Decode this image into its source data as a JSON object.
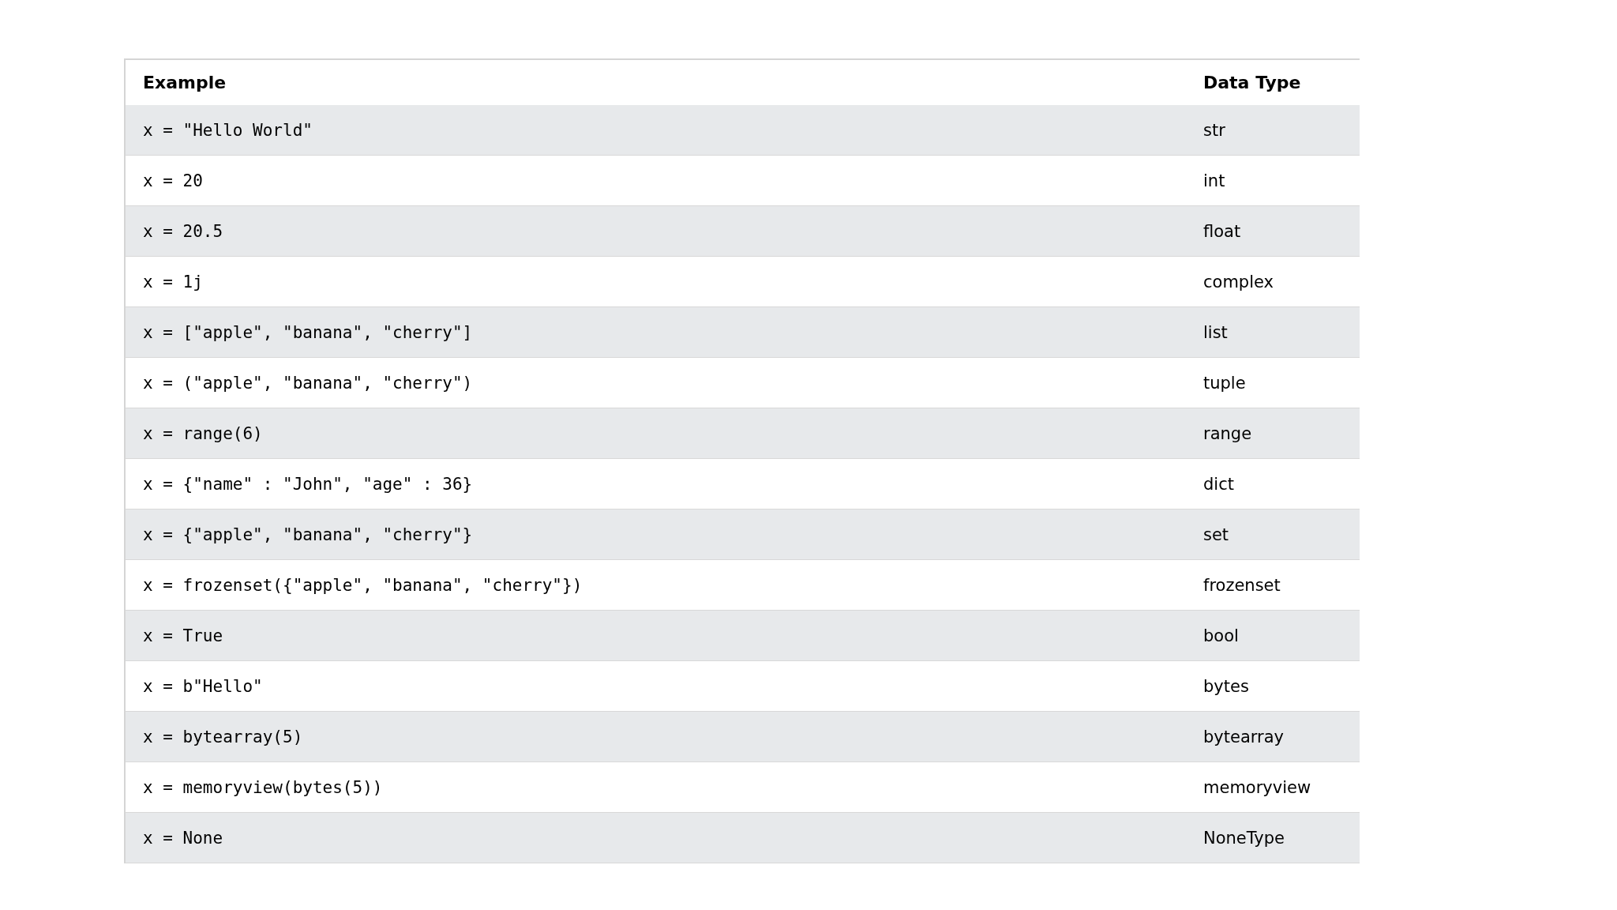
{
  "table": {
    "columns": [
      "Example",
      "Data Type"
    ],
    "rows": [
      {
        "example": "x = \"Hello World\"",
        "type": "str"
      },
      {
        "example": "x = 20",
        "type": "int"
      },
      {
        "example": "x = 20.5",
        "type": "float"
      },
      {
        "example": "x = 1j",
        "type": "complex"
      },
      {
        "example": "x = [\"apple\", \"banana\", \"cherry\"]",
        "type": "list"
      },
      {
        "example": "x = (\"apple\", \"banana\", \"cherry\")",
        "type": "tuple"
      },
      {
        "example": "x = range(6)",
        "type": "range"
      },
      {
        "example": "x = {\"name\" : \"John\", \"age\" : 36}",
        "type": "dict"
      },
      {
        "example": "x = {\"apple\", \"banana\", \"cherry\"}",
        "type": "set"
      },
      {
        "example": "x = frozenset({\"apple\", \"banana\", \"cherry\"})",
        "type": "frozenset"
      },
      {
        "example": "x = True",
        "type": "bool"
      },
      {
        "example": "x = b\"Hello\"",
        "type": "bytes"
      },
      {
        "example": "x = bytearray(5)",
        "type": "bytearray"
      },
      {
        "example": "x = memoryview(bytes(5))",
        "type": "memoryview"
      },
      {
        "example": "x = None",
        "type": "NoneType"
      }
    ]
  }
}
